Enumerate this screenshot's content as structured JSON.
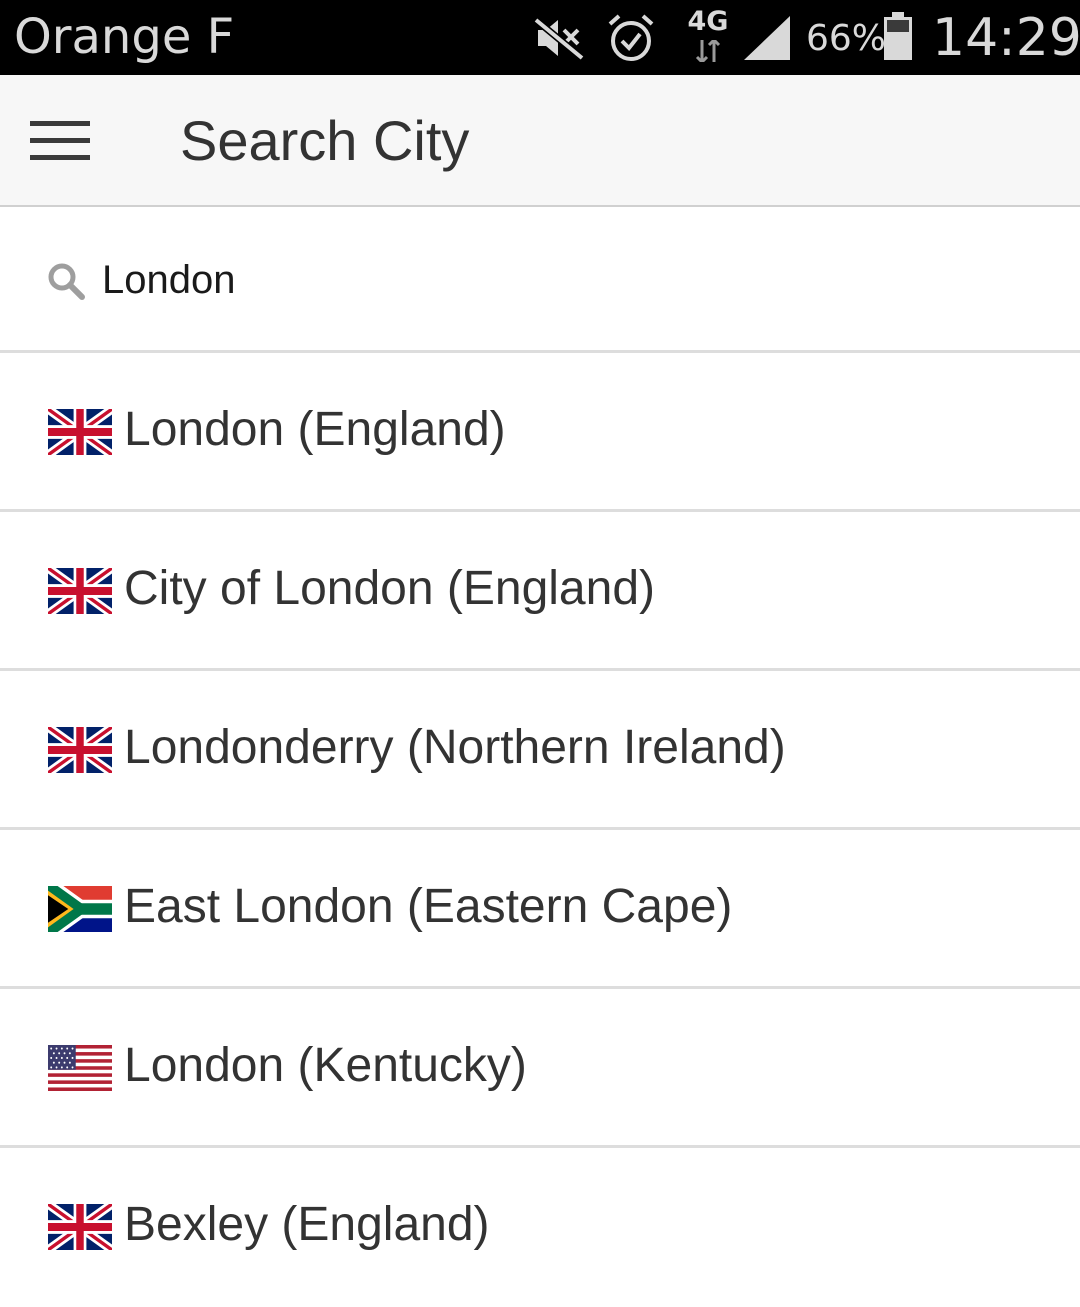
{
  "status_bar": {
    "carrier": "Orange F",
    "network_type": "4G",
    "battery_percent": "66%",
    "time": "14:29",
    "icons": [
      "mute-icon",
      "alarm-icon",
      "data-arrows-icon",
      "signal-icon",
      "battery-icon"
    ]
  },
  "app_bar": {
    "menu_icon": "hamburger-menu-icon",
    "title": "Search City"
  },
  "search": {
    "icon": "search-icon",
    "value": "London"
  },
  "results": [
    {
      "label": "London (England)",
      "flag": "uk-flag-icon"
    },
    {
      "label": "City of London (England)",
      "flag": "uk-flag-icon"
    },
    {
      "label": "Londonderry (Northern Ireland)",
      "flag": "uk-flag-icon"
    },
    {
      "label": "East London (Eastern Cape)",
      "flag": "south-africa-flag-icon"
    },
    {
      "label": "London (Kentucky)",
      "flag": "usa-flag-icon"
    },
    {
      "label": "Bexley (England)",
      "flag": "uk-flag-icon"
    }
  ],
  "colors": {
    "status_bar_bg": "#000000",
    "app_bar_bg": "#f7f7f7",
    "text_primary": "#333333",
    "divider": "#dddddd"
  }
}
